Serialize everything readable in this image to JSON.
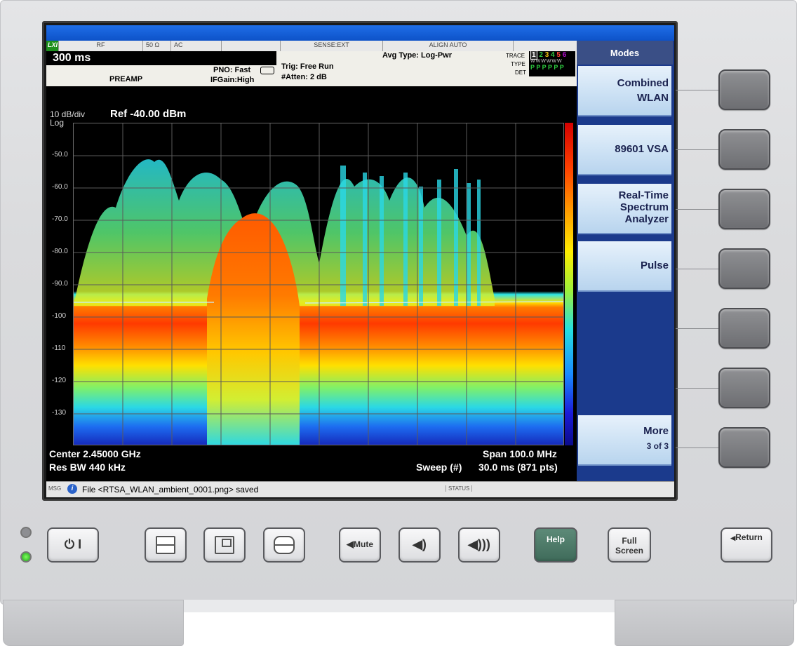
{
  "status_bar": {
    "rf": "RF",
    "impedance": "50 Ω",
    "coupling": "AC",
    "sense": "SENSE:EXT",
    "align": "ALIGN AUTO"
  },
  "header": {
    "sweep_time": "300 ms",
    "preamp": "PREAMP",
    "pno": "PNO: Fast",
    "ifgain": "IFGain:High",
    "trigger": "Trig: Free Run",
    "atten": "#Atten: 2 dB",
    "avg_type": "Avg Type: Log-Pwr",
    "trace_label": "TRACE",
    "type_label": "TYPE",
    "det_label": "DET",
    "trace_numbers": [
      "1",
      "2",
      "3",
      "4",
      "5",
      "6"
    ],
    "det_values": "P P P P P P",
    "type_values": "WWWWWW"
  },
  "plot": {
    "scale": "10 dB/div",
    "log": "Log",
    "ref_level": "Ref -40.00 dBm",
    "y_ticks": [
      "-50.0",
      "-60.0",
      "-70.0",
      "-80.0",
      "-90.0",
      "-100",
      "-110",
      "-120",
      "-130"
    ],
    "center": "Center 2.45000 GHz",
    "res_bw": "Res BW 440 kHz",
    "span": "Span 100.0 MHz",
    "sweep": "Sweep (#)",
    "sweep_value": "30.0 ms (871 pts)"
  },
  "message_bar": {
    "msg_label": "MSG",
    "message": "File <RTSA_WLAN_ambient_0001.png> saved",
    "status_label": "STATUS"
  },
  "softkeys": {
    "title": "Modes",
    "items": [
      {
        "line1": "Combined",
        "line2": "WLAN"
      },
      {
        "line1": "89601 VSA"
      },
      {
        "line1": "Real-Time",
        "line2": "Spectrum",
        "line3": "Analyzer"
      },
      {
        "line1": "Pulse"
      },
      {
        "line1": "More",
        "sub": "3 of 3"
      }
    ]
  },
  "hardware": {
    "mute": "Mute",
    "help": "Help",
    "full_screen_1": "Full",
    "full_screen_2": "Screen",
    "return": "Return"
  },
  "colors": {
    "title_bar": "#0d52c8",
    "softkey_panel": "#1b3a8c",
    "help_button": "#3f6b5a"
  }
}
